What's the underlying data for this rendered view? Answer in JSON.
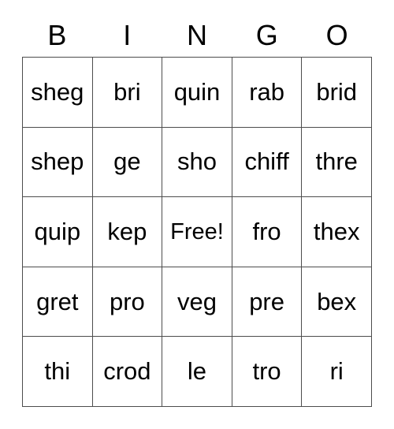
{
  "card": {
    "header": {
      "letters": [
        "B",
        "I",
        "N",
        "G",
        "O"
      ]
    },
    "grid": {
      "rows": 5,
      "columns": 5,
      "cells": [
        [
          "sheg",
          "bri",
          "quin",
          "rab",
          "brid"
        ],
        [
          "shep",
          "ge",
          "sho",
          "chiff",
          "thre"
        ],
        [
          "quip",
          "kep",
          "Free!",
          "fro",
          "thex"
        ],
        [
          "gret",
          "pro",
          "veg",
          "pre",
          "bex"
        ],
        [
          "thi",
          "crod",
          "le",
          "tro",
          "ri"
        ]
      ],
      "free_space": {
        "row": 2,
        "column": 2,
        "label": "Free!"
      }
    },
    "colors": {
      "background": "#ffffff",
      "text": "#000000",
      "border": "#4d4d4d"
    }
  }
}
